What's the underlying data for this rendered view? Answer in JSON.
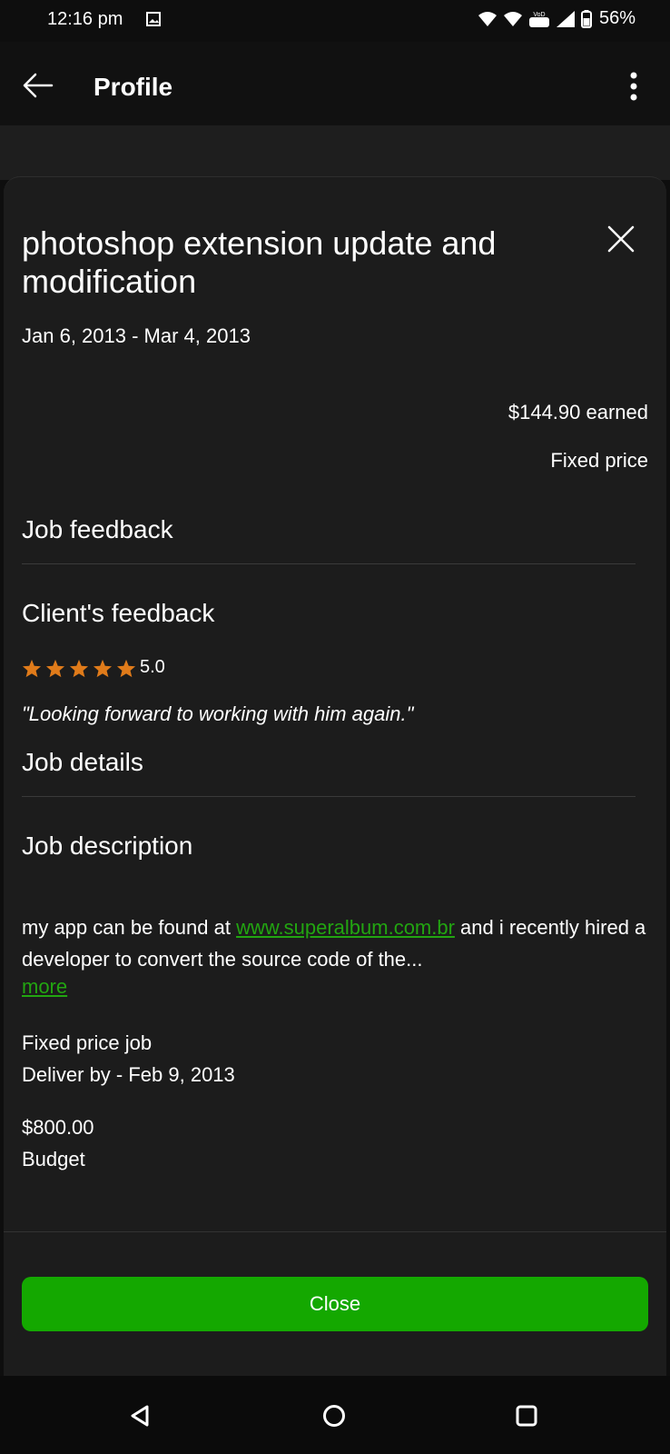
{
  "status_bar": {
    "time": "12:16 pm",
    "battery_percent": "56%"
  },
  "app_bar": {
    "title": "Profile"
  },
  "sheet": {
    "title": "photoshop extension update and modification",
    "date_range": "Jan 6, 2013 - Mar 4, 2013",
    "earned": "$144.90 earned",
    "price_type": "Fixed price",
    "job_feedback_heading": "Job feedback",
    "client_feedback_heading": "Client's feedback",
    "rating": 5.0,
    "rating_label": "5.0",
    "stars_filled": 5,
    "star_color": "#e07b1a",
    "quote": "\"Looking forward to working with him again.\"",
    "job_details_heading": "Job details",
    "job_description_heading": "Job description",
    "description_prefix": "my app can be found at ",
    "description_link": "www.superalbum.com.br",
    "description_suffix": " and i recently hired a developer to convert the source code of the...",
    "more_link": "more",
    "job_type": "Fixed price job",
    "deliver_by": "Deliver by - Feb 9, 2013",
    "budget_amount": "$800.00",
    "budget_label": "Budget",
    "close_button": "Close",
    "accent_color": "#14a800"
  },
  "nav_bar": {
    "icons": [
      "back-triangle-icon",
      "home-circle-icon",
      "recents-square-icon"
    ]
  }
}
